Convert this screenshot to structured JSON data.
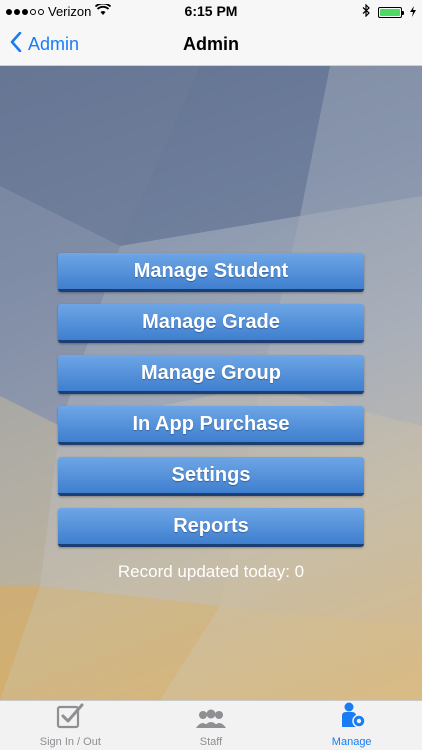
{
  "status": {
    "carrier": "Verizon",
    "time": "6:15 PM"
  },
  "nav": {
    "back_label": "Admin",
    "title": "Admin"
  },
  "menu": [
    {
      "label": "Manage Student"
    },
    {
      "label": "Manage Grade"
    },
    {
      "label": "Manage Group"
    },
    {
      "label": "In App Purchase"
    },
    {
      "label": "Settings"
    },
    {
      "label": "Reports"
    }
  ],
  "record_text": "Record updated today: 0",
  "tabs": [
    {
      "label": "Sign In / Out",
      "icon": "checkbox-icon"
    },
    {
      "label": "Staff",
      "icon": "people-icon"
    },
    {
      "label": "Manage",
      "icon": "manage-person-gear-icon",
      "active": true
    }
  ],
  "colors": {
    "accent": "#1a7cf5",
    "button": "#4a8ad8",
    "battery": "#4cd964"
  }
}
